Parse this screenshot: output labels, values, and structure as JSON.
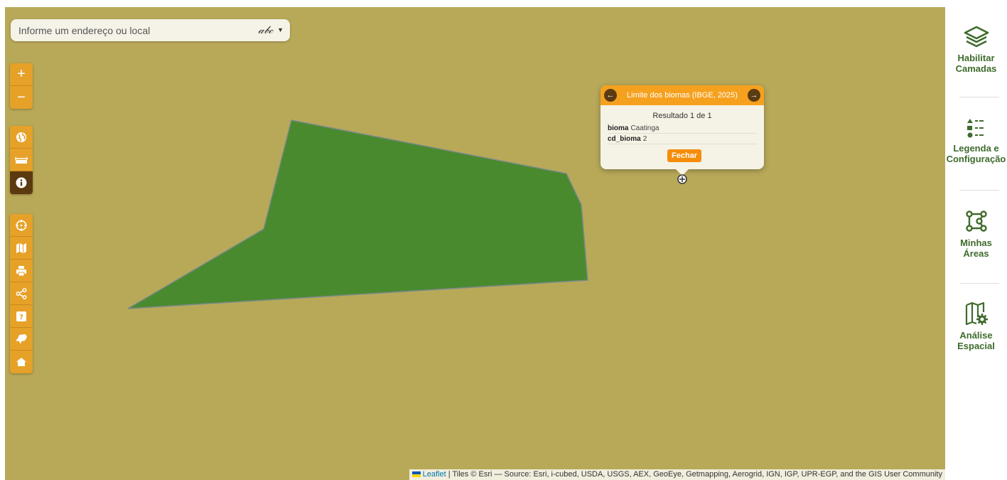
{
  "search": {
    "placeholder": "Informe um endereço ou local",
    "mode_label": "abc"
  },
  "toolbar": {
    "zoom": [
      {
        "icon": "plus-icon",
        "label": "+"
      },
      {
        "icon": "minus-icon",
        "label": "−"
      }
    ],
    "group2": [
      {
        "icon": "globe-icon"
      },
      {
        "icon": "ruler-icon"
      },
      {
        "icon": "info-icon",
        "active": true
      }
    ],
    "group3": [
      {
        "icon": "crosshair-icon"
      },
      {
        "icon": "map-icon"
      },
      {
        "icon": "print-icon"
      },
      {
        "icon": "share-icon"
      },
      {
        "icon": "help-icon"
      },
      {
        "icon": "region-icon"
      },
      {
        "icon": "home-icon"
      }
    ]
  },
  "popup": {
    "title": "Limite dos biomas (IBGE, 2025)",
    "result": "Resultado 1 de 1",
    "fields": [
      {
        "key": "bioma",
        "value": "Caatinga"
      },
      {
        "key": "cd_bioma",
        "value": "2"
      }
    ],
    "close_label": "Fechar"
  },
  "sidebar": {
    "items": [
      {
        "line1": "Habilitar",
        "line2": "Camadas",
        "icon": "layers-icon"
      },
      {
        "line1": "Legenda e",
        "line2": "Configuração",
        "icon": "legend-icon"
      },
      {
        "line1": "Minhas",
        "line2": "Áreas",
        "icon": "polygon-icon"
      },
      {
        "line1": "Análise",
        "line2": "Espacial",
        "icon": "map-gear-icon"
      }
    ]
  },
  "attribution": {
    "link": "Leaflet",
    "text": " | Tiles © Esri — Source: Esri, i-cubed, USDA, USGS, AEX, GeoEye, Getmapping, Aerogrid, IGN, IGP, UPR-EGP, and the GIS User Community"
  },
  "colors": {
    "background": "#b8a959",
    "polygon": "#4a8a2f",
    "accent": "#e5a128",
    "sidebar_text": "#3f6b2c"
  }
}
